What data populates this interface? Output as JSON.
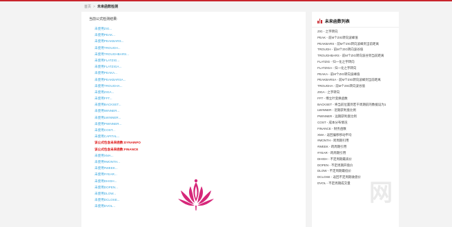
{
  "breadcrumb": {
    "home": "首页",
    "separator": ">",
    "current": "未来函数检测"
  },
  "main": {
    "intro": "当前公式检测结果:",
    "results": [
      {
        "text": "未使用ZIG...",
        "type": "normal"
      },
      {
        "text": "未使用PEAK...",
        "type": "normal"
      },
      {
        "text": "未使用PEAKBARS...",
        "type": "normal"
      },
      {
        "text": "未使用TROUGH...",
        "type": "normal"
      },
      {
        "text": "未使用TROUGHBARS...",
        "type": "normal"
      },
      {
        "text": "未使用FLATZIG...",
        "type": "normal"
      },
      {
        "text": "未使用FLATZIGA...",
        "type": "normal"
      },
      {
        "text": "未使用PEAKA...",
        "type": "normal"
      },
      {
        "text": "未使用PEAKBARSA...",
        "type": "normal"
      },
      {
        "text": "未使用TROUGHA...",
        "type": "normal"
      },
      {
        "text": "未使用ZIGA...",
        "type": "normal"
      },
      {
        "text": "未使用FFT...",
        "type": "normal"
      },
      {
        "text": "未使用BACKSET...",
        "type": "normal"
      },
      {
        "text": "未使用WINNER...",
        "type": "normal"
      },
      {
        "text": "未使用LWINNER...",
        "type": "normal"
      },
      {
        "text": "未使用PWINNER...",
        "type": "normal"
      },
      {
        "text": "未使用COST...",
        "type": "normal"
      },
      {
        "text": "未使用CAPITAL...",
        "type": "normal"
      },
      {
        "text": "该公式包含未来函数:DYNAINFO",
        "type": "error"
      },
      {
        "text": "该公式包含未来函数:FINANCE",
        "type": "error"
      },
      {
        "text": "未使用XMA...",
        "type": "normal"
      },
      {
        "text": "未使用#MONTH...",
        "type": "normal"
      },
      {
        "text": "未使用#WEEK...",
        "type": "normal"
      },
      {
        "text": "未使用#YEAR...",
        "type": "normal"
      },
      {
        "text": "未使用DHIGH...",
        "type": "normal"
      },
      {
        "text": "未使用DOPEN...",
        "type": "normal"
      },
      {
        "text": "未使用DLOW...",
        "type": "normal"
      },
      {
        "text": "未使用DCLOSE...",
        "type": "normal"
      },
      {
        "text": "未使用DVOL...",
        "type": "normal"
      }
    ]
  },
  "sidebar": {
    "title": "未来函数列表",
    "items": [
      "ZIG - 之字转向",
      "PEAK - 前M个ZIG转向波峰值",
      "PEAKBARS - 前M个ZIG转向波峰到当前距离",
      "TROUGH - 前M个ZIG转向波谷值",
      "TROUGHBARS - 前M个ZIG转向波谷到当前距离",
      "FLATZIG - 归一化之字转向",
      "FLATZIGA - 归一化之字转向",
      "PEAKA - 前M个ZIG转向波峰值",
      "PEAKBARSA - 前M个ZIG转向波峰到当前距离",
      "TROUGHA - 前M个ZIG转向波谷值",
      "ZIGA - 之字转向",
      "FFT - 傅立叶变换函数",
      "BACKSET - 将当前位置到若干周期前的数据设为1",
      "LWINNER - 近期获利盘比例",
      "PWINNER - 远期获利盘比例",
      "COST - 成本分布情况",
      "FINANCE - 财务函数",
      "XMA - 返回偏移移动平均",
      "#MONTH - 跨周期引用",
      "#WEEK - 跨周期引用",
      "#YEAR - 跨周期引用",
      "DHIGH - 不定周期最高价",
      "DOPEN - 不定周期开盘价",
      "DLOW - 不定周期最低价",
      "DCLOSE - 返回不定周期收盘价",
      "DVOL - 不定周期成交量"
    ]
  },
  "colors": {
    "accent": "#c8252c",
    "link": "#3aa8e0",
    "error": "#dd1111",
    "logo": "#d6287a"
  }
}
